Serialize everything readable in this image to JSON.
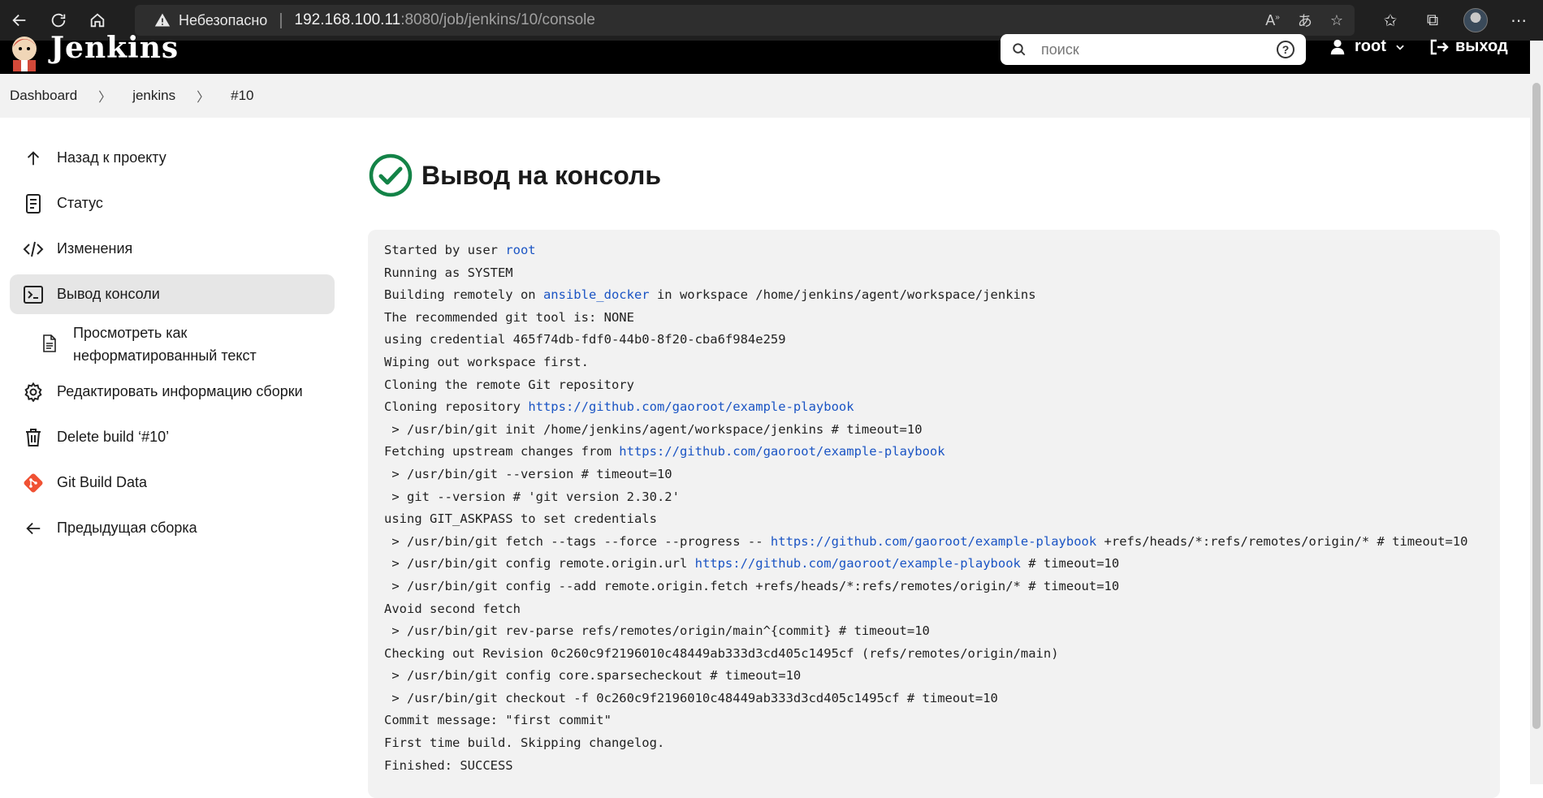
{
  "browser": {
    "insecure_label": "Небезопасно",
    "url_host": "192.168.100.11",
    "url_rest": ":8080/job/jenkins/10/console"
  },
  "header": {
    "app_title": "Jenkins",
    "search_placeholder": "поиск",
    "help_label": "?",
    "user_name": "root",
    "logout_label": "выход"
  },
  "breadcrumb": [
    "Dashboard",
    "jenkins",
    "#10"
  ],
  "sidebar": {
    "items": [
      {
        "label": "Назад к проекту",
        "icon": "arrow-up-icon"
      },
      {
        "label": "Статус",
        "icon": "document-icon"
      },
      {
        "label": "Изменения",
        "icon": "code-icon"
      },
      {
        "label": "Вывод консоли",
        "icon": "terminal-icon",
        "active": true
      },
      {
        "label": "Редактировать информацию сборки",
        "icon": "gear-icon"
      },
      {
        "label": "Delete build ‘#10’",
        "icon": "trash-icon"
      },
      {
        "label": "Git Build Data",
        "icon": "git-icon"
      },
      {
        "label": "Предыдущая сборка",
        "icon": "arrow-left-icon"
      }
    ],
    "sub_item": {
      "line1": "Просмотреть как",
      "line2": "неформатированный текст"
    }
  },
  "main": {
    "title": "Вывод на консоль",
    "status_color": "#138347"
  },
  "console": {
    "lines": [
      [
        {
          "t": "Started by user "
        },
        {
          "t": "root",
          "link": true
        }
      ],
      [
        {
          "t": "Running as SYSTEM"
        }
      ],
      [
        {
          "t": "Building remotely on "
        },
        {
          "t": "ansible_docker",
          "link": true
        },
        {
          "t": " in workspace /home/jenkins/agent/workspace/jenkins"
        }
      ],
      [
        {
          "t": "The recommended git tool is: NONE"
        }
      ],
      [
        {
          "t": "using credential 465f74db-fdf0-44b0-8f20-cba6f984e259"
        }
      ],
      [
        {
          "t": "Wiping out workspace first."
        }
      ],
      [
        {
          "t": "Cloning the remote Git repository"
        }
      ],
      [
        {
          "t": "Cloning repository "
        },
        {
          "t": "https://github.com/gaoroot/example-playbook",
          "link": true
        }
      ],
      [
        {
          "t": " > /usr/bin/git init /home/jenkins/agent/workspace/jenkins # timeout=10"
        }
      ],
      [
        {
          "t": "Fetching upstream changes from "
        },
        {
          "t": "https://github.com/gaoroot/example-playbook",
          "link": true
        }
      ],
      [
        {
          "t": " > /usr/bin/git --version # timeout=10"
        }
      ],
      [
        {
          "t": " > git --version # 'git version 2.30.2'"
        }
      ],
      [
        {
          "t": "using GIT_ASKPASS to set credentials"
        }
      ],
      [
        {
          "t": " > /usr/bin/git fetch --tags --force --progress -- "
        },
        {
          "t": "https://github.com/gaoroot/example-playbook",
          "link": true
        },
        {
          "t": " +refs/heads/*:refs/remotes/origin/* # timeout=10"
        }
      ],
      [
        {
          "t": " > /usr/bin/git config remote.origin.url "
        },
        {
          "t": "https://github.com/gaoroot/example-playbook",
          "link": true
        },
        {
          "t": " # timeout=10"
        }
      ],
      [
        {
          "t": " > /usr/bin/git config --add remote.origin.fetch +refs/heads/*:refs/remotes/origin/* # timeout=10"
        }
      ],
      [
        {
          "t": "Avoid second fetch"
        }
      ],
      [
        {
          "t": " > /usr/bin/git rev-parse refs/remotes/origin/main^{commit} # timeout=10"
        }
      ],
      [
        {
          "t": "Checking out Revision 0c260c9f2196010c48449ab333d3cd405c1495cf (refs/remotes/origin/main)"
        }
      ],
      [
        {
          "t": " > /usr/bin/git config core.sparsecheckout # timeout=10"
        }
      ],
      [
        {
          "t": " > /usr/bin/git checkout -f 0c260c9f2196010c48449ab333d3cd405c1495cf # timeout=10"
        }
      ],
      [
        {
          "t": "Commit message: \"first commit\""
        }
      ],
      [
        {
          "t": "First time build. Skipping changelog."
        }
      ],
      [
        {
          "t": "Finished: SUCCESS"
        }
      ]
    ]
  }
}
